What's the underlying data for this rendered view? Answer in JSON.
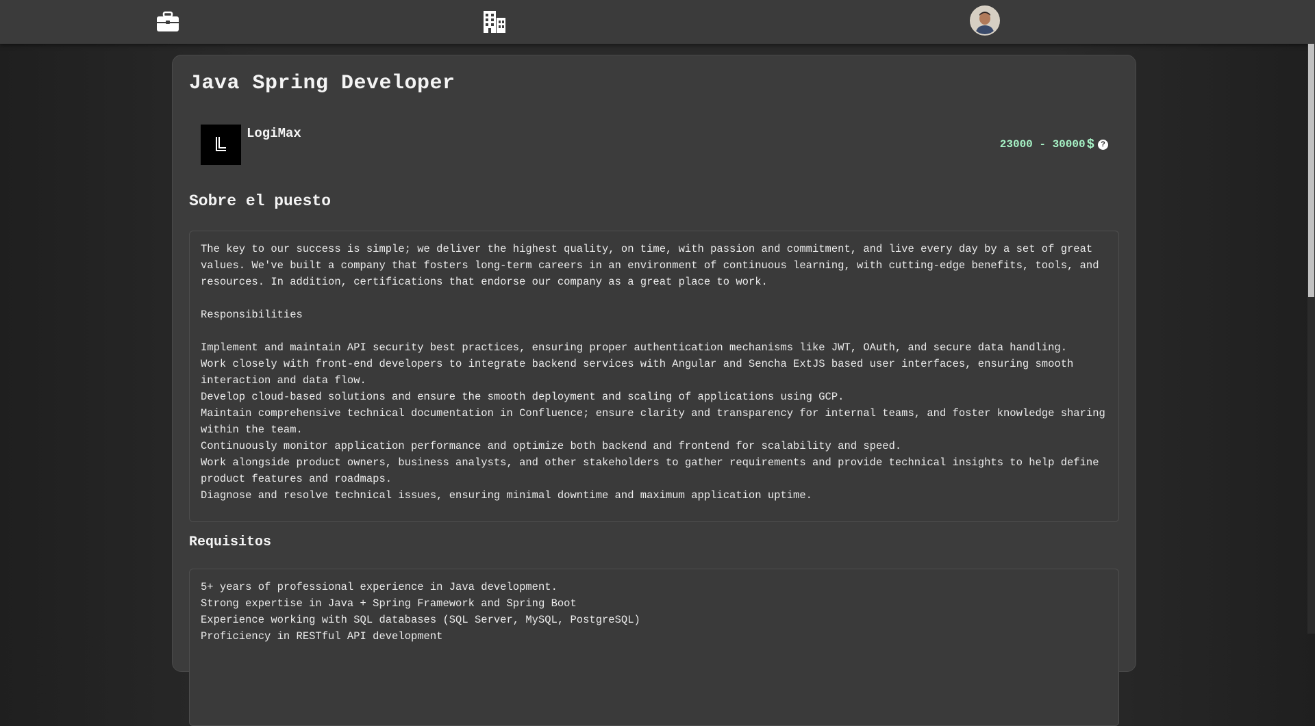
{
  "nav": {
    "jobs_icon": "briefcase-icon",
    "companies_icon": "building-icon",
    "profile_icon": "avatar"
  },
  "job": {
    "title": "Java Spring Developer",
    "company": "LogiMax",
    "salary_range": "23000 - 30000",
    "currency": "$",
    "help": "?"
  },
  "about": {
    "heading": "Sobre el puesto",
    "text": "The key to our success is simple; we deliver the highest quality, on time, with passion and commitment, and live every day by a set of great values. We've built a company that fosters long-term careers in an environment of continuous learning, with cutting-edge benefits, tools, and resources. In addition, certifications that endorse our company as a great place to work.\n\nResponsibilities\n\nImplement and maintain API security best practices, ensuring proper authentication mechanisms like JWT, OAuth, and secure data handling.\nWork closely with front-end developers to integrate backend services with Angular and Sencha ExtJS based user interfaces, ensuring smooth interaction and data flow.\nDevelop cloud-based solutions and ensure the smooth deployment and scaling of applications using GCP.\nMaintain comprehensive technical documentation in Confluence; ensure clarity and transparency for internal teams, and foster knowledge sharing within the team.\nContinuously monitor application performance and optimize both backend and frontend for scalability and speed.\nWork alongside product owners, business analysts, and other stakeholders to gather requirements and provide technical insights to help define product features and roadmaps.\nDiagnose and resolve technical issues, ensuring minimal downtime and maximum application uptime."
  },
  "requirements": {
    "heading": "Requisitos",
    "text": "5+ years of professional experience in Java development.\nStrong expertise in Java + Spring Framework and Spring Boot\nExperience working with SQL databases (SQL Server, MySQL, PostgreSQL)\nProficiency in RESTful API development"
  },
  "colors": {
    "topbar": "#3b3b3b",
    "card": "#3c3c3c",
    "salary": "#a7f3c6"
  }
}
